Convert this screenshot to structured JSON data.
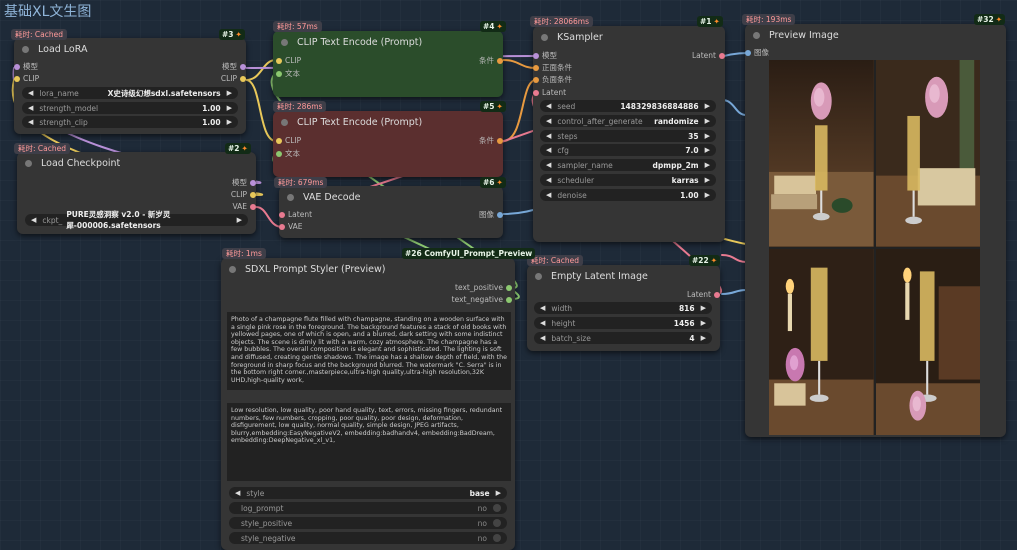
{
  "workflow_title": "基础XL文生图",
  "colors": {
    "wire_yellow": "#e8c85a",
    "wire_orange": "#e89a40",
    "wire_pink": "#e87a90",
    "wire_blue": "#78a8d8",
    "wire_purple": "#b890d8"
  },
  "nodes": {
    "load_lora": {
      "timing": "耗时: Cached",
      "badge": "#3",
      "title": "Load LoRA",
      "inputs": [
        "模型",
        "CLIP"
      ],
      "outputs": [
        "模型",
        "CLIP"
      ],
      "widgets": [
        {
          "label": "lora_name",
          "value": "X史诗级幻想sdxl.safetensors"
        },
        {
          "label": "strength_model",
          "value": "1.00"
        },
        {
          "label": "strength_clip",
          "value": "1.00"
        }
      ]
    },
    "load_checkpoint": {
      "timing": "耗时: Cached",
      "badge": "#2",
      "title": "Load Checkpoint",
      "outputs": [
        "模型",
        "CLIP",
        "VAE"
      ],
      "widget": {
        "label": "ckpt_",
        "value": "PURE灵感洞察 v2.0 - 新岁灵犀-000006.safetensors"
      }
    },
    "clip_pos": {
      "timing": "耗时: 57ms",
      "badge": "#4",
      "title": "CLIP Text Encode (Prompt)",
      "inputs": [
        "CLIP",
        "文本"
      ],
      "output": "条件"
    },
    "clip_neg": {
      "timing": "耗时: 286ms",
      "badge": "#5",
      "title": "CLIP Text Encode (Prompt)",
      "inputs": [
        "CLIP",
        "文本"
      ],
      "output": "条件"
    },
    "vae_decode": {
      "timing": "耗时: 679ms",
      "badge": "#6",
      "title": "VAE Decode",
      "inputs": [
        "Latent",
        "VAE"
      ],
      "output": "图像"
    },
    "ksampler": {
      "timing": "耗时: 28066ms",
      "badge": "#1",
      "title": "KSampler",
      "inputs": [
        "模型",
        "正面条件",
        "负面条件",
        "Latent"
      ],
      "output": "Latent",
      "widgets": [
        {
          "label": "seed",
          "value": "148329836884886"
        },
        {
          "label": "control_after_generate",
          "value": "randomize"
        },
        {
          "label": "steps",
          "value": "35"
        },
        {
          "label": "cfg",
          "value": "7.0"
        },
        {
          "label": "sampler_name",
          "value": "dpmpp_2m"
        },
        {
          "label": "scheduler",
          "value": "karras"
        },
        {
          "label": "denoise",
          "value": "1.00"
        }
      ]
    },
    "preview": {
      "timing": "耗时: 193ms",
      "badge": "#32",
      "title": "Preview Image",
      "input": "图像"
    },
    "empty_latent": {
      "timing": "耗时: Cached",
      "badge": "#22",
      "title": "Empty Latent Image",
      "output": "Latent",
      "widgets": [
        {
          "label": "width",
          "value": "816"
        },
        {
          "label": "height",
          "value": "1456"
        },
        {
          "label": "batch_size",
          "value": "4"
        }
      ]
    },
    "styler": {
      "timing": "耗时: 1ms",
      "badge": "#26 ComfyUI_Prompt_Preview",
      "title": "SDXL Prompt Styler (Preview)",
      "outputs": [
        "text_positive",
        "text_negative"
      ],
      "positive_text": "Photo of a champagne flute filled with champagne, standing on a wooden surface with a single pink rose in the foreground. The background features a stack of old books with yellowed pages, one of which is open, and a blurred, dark setting with some indistinct objects. The scene is dimly lit with a warm, cozy atmosphere. The champagne has a few bubbles. The overall composition is elegant and sophisticated. The lighting is soft and diffused, creating gentle shadows. The image has a shallow depth of field, with the foreground in sharp focus and the background blurred. The watermark \"C. Serra\" is in the bottom right corner.,masterpiece,ultra-high quality,ultra-high resolution,32K UHD,high-quality work,",
      "negative_text": "Low resolution, low quality, poor hand quality, text, errors, missing fingers, redundant numbers, few numbers, cropping, poor quality, poor design, deformation, disfigurement, low quality, normal quality, simple design, JPEG artifacts, blurry,embedding:EasyNegativeV2, embedding:badhandv4, embedding:BadDream, embedding:DeepNegative_xl_v1,",
      "style": {
        "label": "style",
        "value": "base"
      },
      "toggles": [
        {
          "label": "log_prompt",
          "value": "no"
        },
        {
          "label": "style_positive",
          "value": "no"
        },
        {
          "label": "style_negative",
          "value": "no"
        }
      ]
    }
  }
}
